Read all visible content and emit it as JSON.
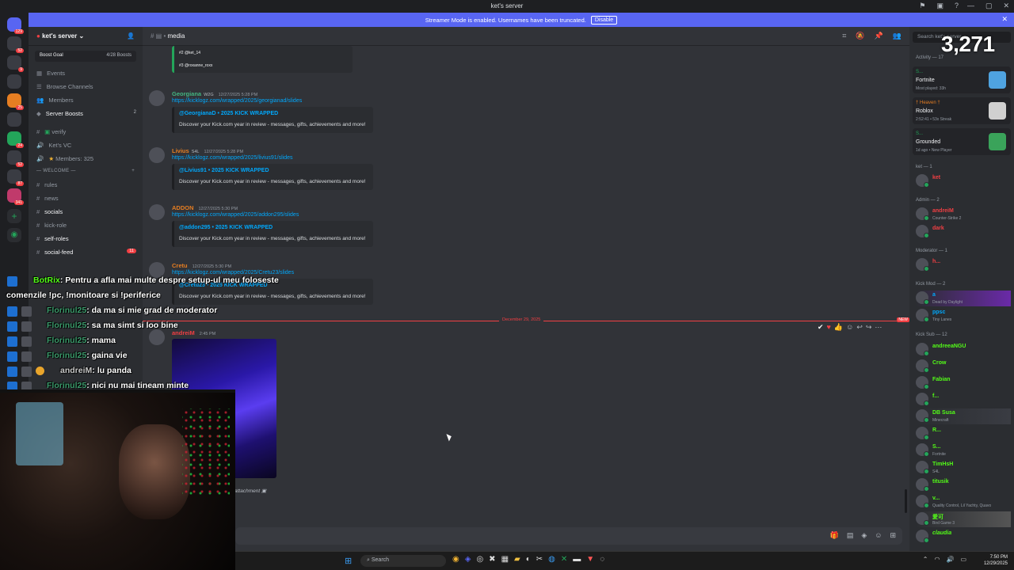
{
  "window": {
    "title": "ket's server"
  },
  "banner": {
    "text": "Streamer Mode is enabled. Usernames have been truncated.",
    "button": "Disable"
  },
  "server": {
    "name": "ket's server",
    "boost_goal": "Boost Goal",
    "boosts": "4/28 Boosts"
  },
  "sidebar": {
    "items": [
      {
        "label": "Events"
      },
      {
        "label": "Browse Channels"
      },
      {
        "label": "Members"
      },
      {
        "label": "Server Boosts",
        "badge": "2"
      }
    ],
    "channels_top": [
      {
        "label": "verify"
      },
      {
        "label": "Ket's VC"
      },
      {
        "label": "Members: 325"
      }
    ],
    "category": "WELCOME",
    "channels": [
      {
        "label": "rules"
      },
      {
        "label": "news"
      },
      {
        "label": "socials"
      },
      {
        "label": "kick-role"
      },
      {
        "label": "self-roles"
      },
      {
        "label": "social-feed",
        "badge": "11"
      },
      {
        "label": "art-channel"
      }
    ]
  },
  "header": {
    "channel": "media"
  },
  "messages": [
    {
      "user": "Georgiana",
      "tag": "W2G",
      "time": "12/27/2025 5:28 PM",
      "color": "#43b581",
      "link": "https://kicklogz.com/wrapped/2025/georgianad/slides",
      "embed_title": "@GeorgianaD • 2025 KICK WRAPPED",
      "embed_desc": "Discover your Kick.com year in review - messages, gifts, achievements and more!"
    },
    {
      "user": "Livius",
      "tag": "S4L",
      "time": "12/27/2025 5:28 PM",
      "color": "#e67e22",
      "link": "https://kicklogz.com/wrapped/2025/livius91/slides",
      "embed_title": "@Livius91 • 2025 KICK WRAPPED",
      "embed_desc": "Discover your Kick.com year in review - messages, gifts, achievements and more!"
    },
    {
      "user": "ADDON",
      "tag": "",
      "time": "12/27/2025 5:30 PM",
      "color": "#e67e22",
      "link": "https://kicklogz.com/wrapped/2025/addon295/slides",
      "embed_title": "@addon295 • 2025 KICK WRAPPED",
      "embed_desc": "Discover your Kick.com year in review - messages, gifts, achievements and more!"
    },
    {
      "user": "Cretu",
      "tag": "",
      "time": "12/27/2025 5:30 PM",
      "color": "#e67e22",
      "link": "https://kicklogz.com/wrapped/2025/Cretu23/slides",
      "embed_title": "@Cretu23 • 2025 KICK WRAPPED",
      "embed_desc": "Discover your Kick.com year in review - messages, gifts, achievements and more!"
    }
  ],
  "top_embed_rows": [
    "#2 @ket_14",
    "#3 @roxanne_roxx"
  ],
  "divider": {
    "label": "December 29, 2025",
    "new": "NEW"
  },
  "last_message": {
    "user": "andreiM",
    "time": "2:45 PM",
    "attachment": "attachment"
  },
  "viewer_count": "3,271",
  "activity": {
    "header": "Activity — 17",
    "items": [
      {
        "name": "S...",
        "game": "Fortnite",
        "sub": "Most played: 33h",
        "color": "#4fa3e0"
      },
      {
        "name": "† Heaven †",
        "game": "Roblox",
        "sub": "2:52:41 • 53x Streak",
        "color": "#d0d0d0"
      },
      {
        "name": "S...",
        "game": "Grounded",
        "sub": "1d ago • New Player",
        "color": "#3aa35a"
      }
    ]
  },
  "members": {
    "search_placeholder": "Search ket's server",
    "groups": [
      {
        "role": "ket — 1",
        "list": [
          {
            "name": "ket",
            "sub": "",
            "color": "#f23f43"
          }
        ]
      },
      {
        "role": "Admin — 2",
        "list": [
          {
            "name": "andreiM",
            "sub": "Counter-Strike 2",
            "color": "#f23f43"
          },
          {
            "name": "dark",
            "sub": "",
            "color": "#f23f43"
          }
        ]
      },
      {
        "role": "Moderator — 1",
        "list": [
          {
            "name": "h...",
            "sub": "",
            "color": "#f23f43"
          }
        ]
      },
      {
        "role": "Kick Mod — 2",
        "list": [
          {
            "name": "a",
            "sub": "Dead by Daylight",
            "color": "#00a8fc"
          },
          {
            "name": "ppsc",
            "sub": "Tiny Lanes",
            "color": "#00a8fc"
          }
        ]
      },
      {
        "role": "Kick Sub — 12",
        "list": [
          {
            "name": "andreeaNGU",
            "sub": "",
            "color": "#53fc18"
          },
          {
            "name": "Crow",
            "sub": "",
            "color": "#53fc18"
          },
          {
            "name": "Fabian",
            "sub": "",
            "color": "#53fc18"
          },
          {
            "name": "f...",
            "sub": "",
            "color": "#53fc18"
          },
          {
            "name": "DB Susa",
            "sub": "Minecraft",
            "color": "#53fc18"
          },
          {
            "name": "R...",
            "sub": "",
            "color": "#53fc18"
          },
          {
            "name": "S...",
            "sub": "Fortnite",
            "color": "#53fc18"
          },
          {
            "name": "TimHsH",
            "sub": "S4L",
            "color": "#53fc18"
          },
          {
            "name": "titusik",
            "sub": "",
            "color": "#53fc18"
          },
          {
            "name": "v...",
            "sub": "Quality Control, Lil Yachty, Quavo",
            "color": "#53fc18"
          },
          {
            "name": "愛可",
            "sub": "Bird Game 3",
            "color": "#53fc18"
          },
          {
            "name": "claudia",
            "sub": "S4L",
            "color": "#53fc18"
          }
        ]
      }
    ]
  },
  "overlay": [
    {
      "user": "BotRix",
      "text": "Pentru a afla mai multe despre setup-ul meu foloseste",
      "cls": "u-bot"
    },
    {
      "user": "",
      "text": "comenzile !pc, !monitoare si !periferice",
      "cls": ""
    },
    {
      "user": "Florinul25",
      "text": "da ma si mie grad de moderator",
      "cls": "u-flo"
    },
    {
      "user": "Florinul25",
      "text": "sa ma simt si loo bine",
      "cls": "u-flo"
    },
    {
      "user": "Florinul25",
      "text": "mama",
      "cls": "u-flo"
    },
    {
      "user": "Florinul25",
      "text": "gaina vie",
      "cls": "u-flo"
    },
    {
      "user": "andreiM",
      "text": "lu panda",
      "cls": "u-and"
    },
    {
      "user": "Florinul25",
      "text": "nici nu mai tineam minte",
      "cls": "u-flo"
    }
  ],
  "taskbar": {
    "search": "Search",
    "time": "7:50 PM",
    "date": "12/29/2025"
  }
}
